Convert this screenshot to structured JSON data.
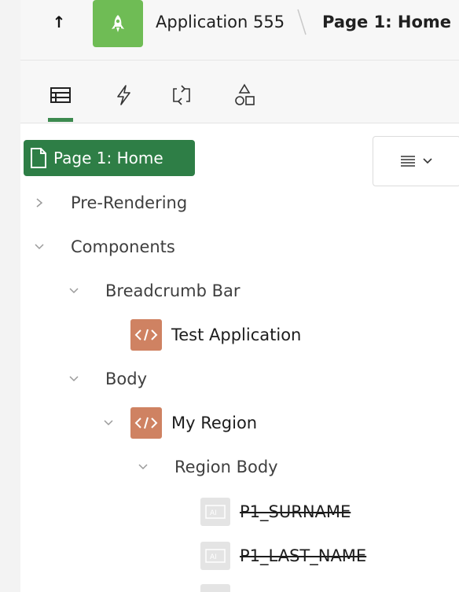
{
  "header": {
    "up_icon": "arrow-up-icon",
    "app_icon": "rocket-icon",
    "app_label": "Application 555",
    "page_label": "Page 1: Home",
    "colors": {
      "app_icon_bg": "#6fbc55"
    }
  },
  "tabs": {
    "items": [
      {
        "name": "rendering",
        "icon": "layout-icon",
        "active": true
      },
      {
        "name": "dynamic-actions",
        "icon": "lightning-icon",
        "active": false
      },
      {
        "name": "processing",
        "icon": "refresh-icon",
        "active": false
      },
      {
        "name": "shared-components",
        "icon": "shapes-icon",
        "active": false
      }
    ],
    "active_color": "#3c8a4f"
  },
  "tree": {
    "root": {
      "label": "Page 1: Home",
      "icon": "document-icon",
      "selected_bg": "#2e7e46"
    },
    "menu_button": {
      "icon": "menu-lines-icon",
      "chevron": "chevron-down-icon"
    },
    "nodes": [
      {
        "label": "Pre-Rendering",
        "expanded": false
      },
      {
        "label": "Components",
        "expanded": true
      },
      {
        "label": "Breadcrumb Bar",
        "expanded": true
      },
      {
        "label": "Test Application",
        "icon": "code-icon"
      },
      {
        "label": "Body",
        "expanded": true
      },
      {
        "label": "My Region",
        "expanded": true,
        "icon": "code-icon"
      },
      {
        "label": "Region Body",
        "expanded": true
      },
      {
        "label": "P1_SURNAME",
        "icon": "item-icon",
        "strikethrough": true
      },
      {
        "label": "P1_LAST_NAME",
        "icon": "item-icon",
        "strikethrough": true
      }
    ]
  }
}
